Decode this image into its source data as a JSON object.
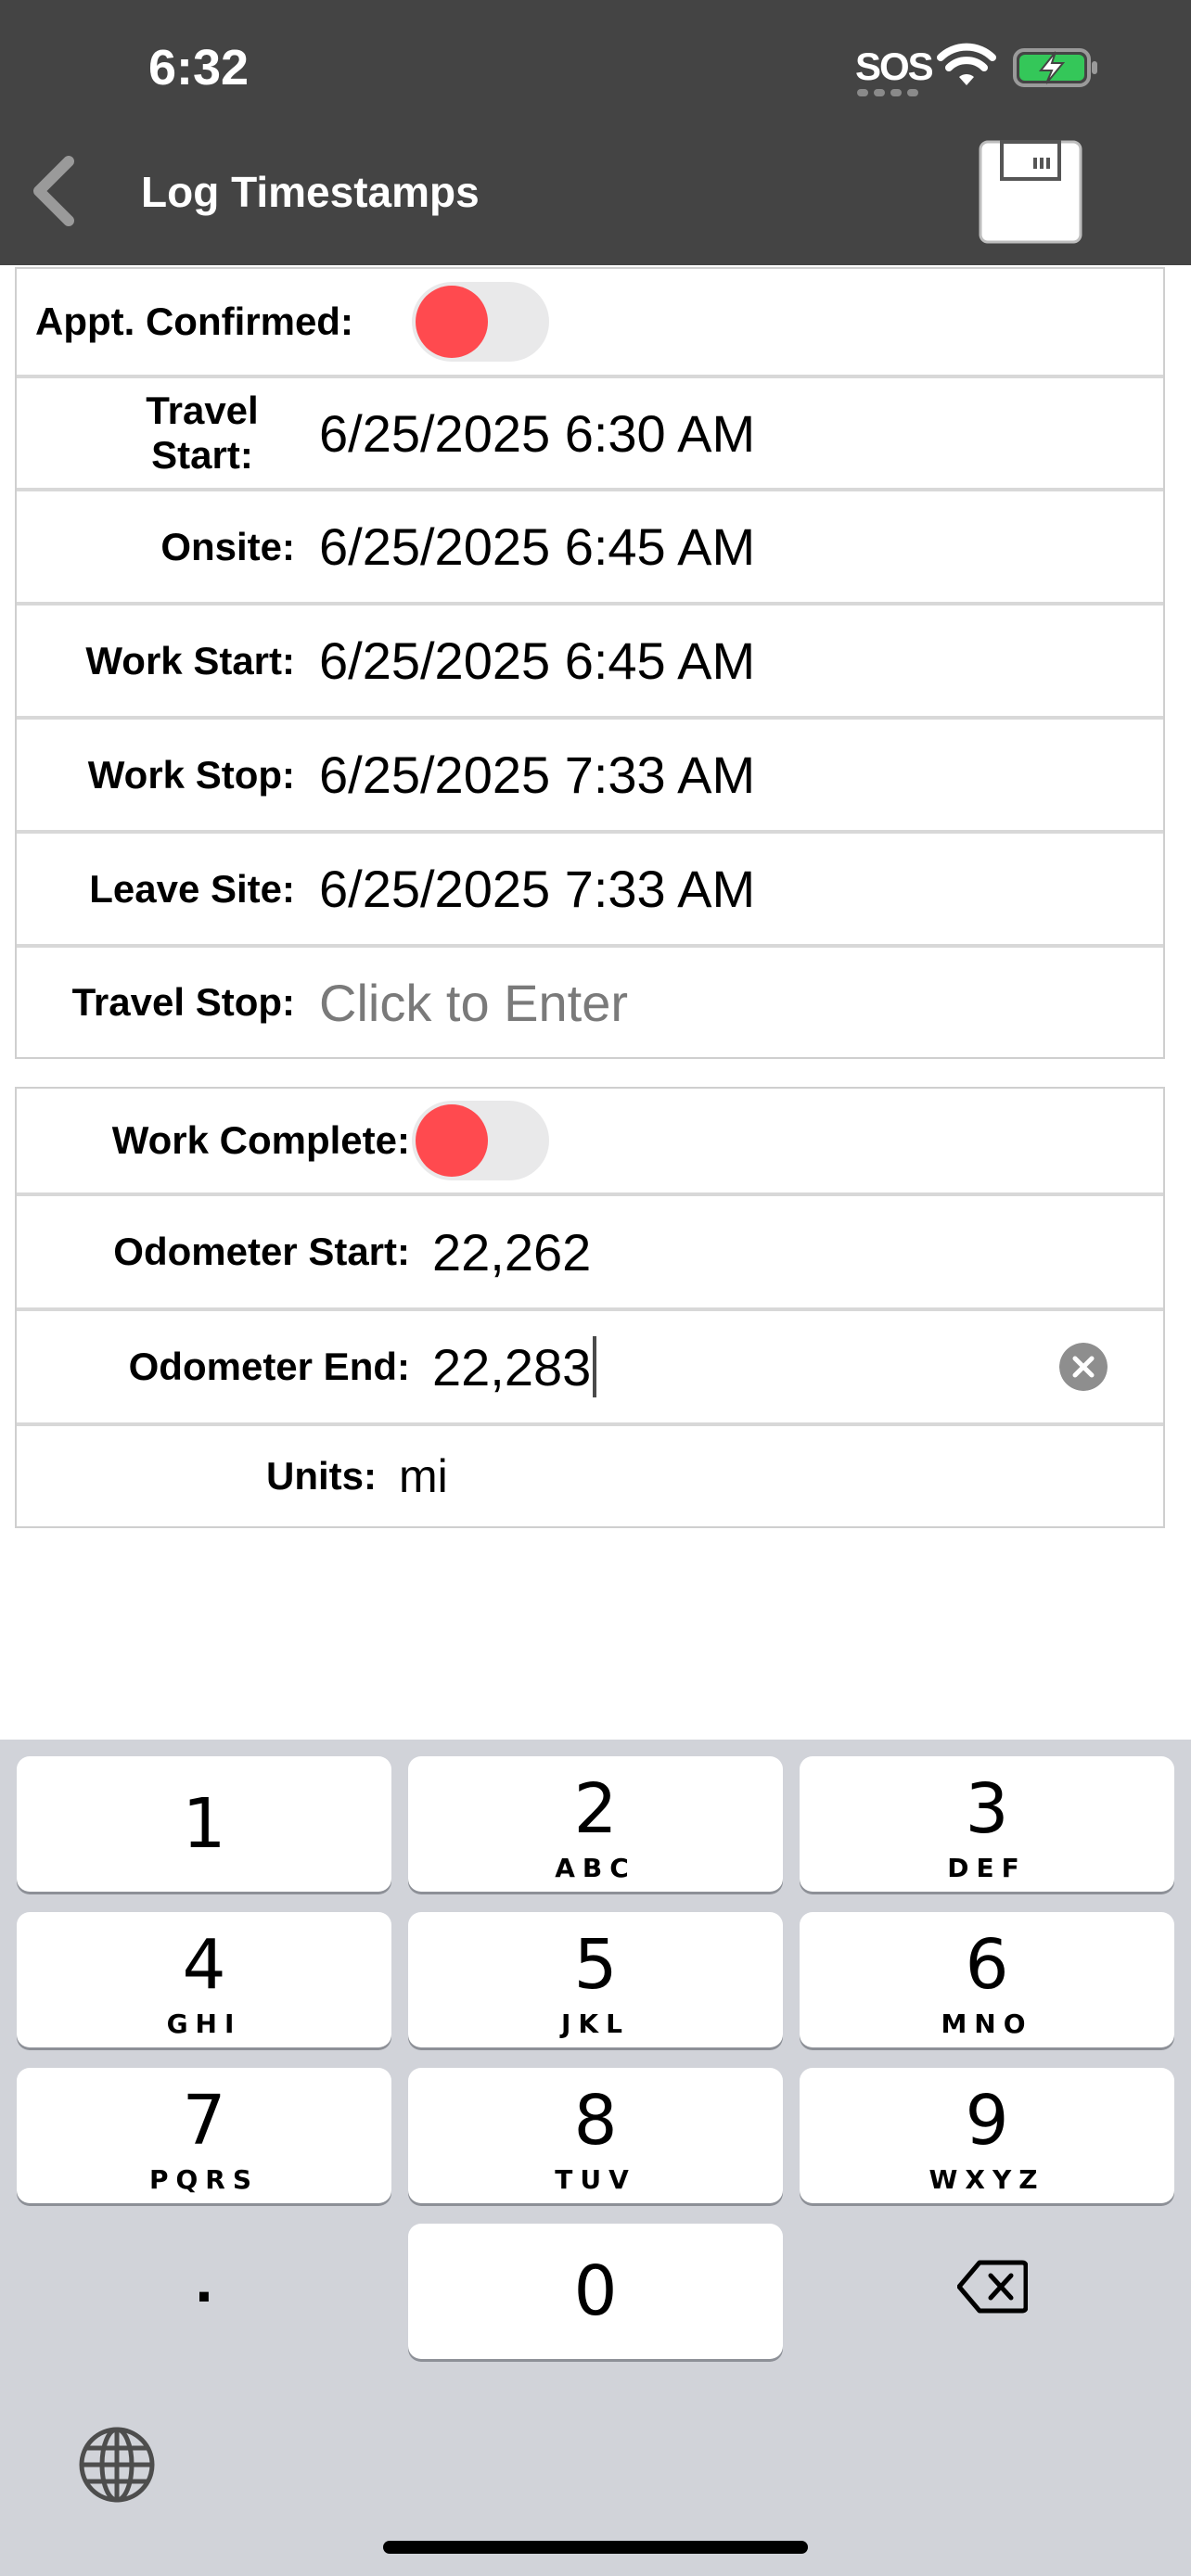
{
  "status_bar": {
    "time": "6:32",
    "sos": "SOS"
  },
  "nav": {
    "title": "Log Timestamps"
  },
  "timestamps_group": {
    "appt_confirmed": {
      "label": "Appt. Confirmed:"
    },
    "rows": [
      {
        "label": "Travel Start:",
        "value": "6/25/2025 6:30 AM"
      },
      {
        "label": "Onsite:",
        "value": "6/25/2025 6:45 AM"
      },
      {
        "label": "Work Start:",
        "value": "6/25/2025 6:45 AM"
      },
      {
        "label": "Work Stop:",
        "value": "6/25/2025 7:33 AM"
      },
      {
        "label": "Leave Site:",
        "value": "6/25/2025 7:33 AM"
      },
      {
        "label": "Travel Stop:",
        "placeholder": "Click to Enter"
      }
    ]
  },
  "completion_group": {
    "work_complete": {
      "label": "Work Complete:"
    },
    "odometer_start": {
      "label": "Odometer Start:",
      "value": "22,262"
    },
    "odometer_end": {
      "label": "Odometer End:",
      "value": "22,283"
    },
    "units": {
      "label": "Units:",
      "value": "mi"
    }
  },
  "keyboard": {
    "keys": [
      {
        "digit": "1",
        "letters": ""
      },
      {
        "digit": "2",
        "letters": "ABC"
      },
      {
        "digit": "3",
        "letters": "DEF"
      },
      {
        "digit": "4",
        "letters": "GHI"
      },
      {
        "digit": "5",
        "letters": "JKL"
      },
      {
        "digit": "6",
        "letters": "MNO"
      },
      {
        "digit": "7",
        "letters": "PQRS"
      },
      {
        "digit": "8",
        "letters": "TUV"
      },
      {
        "digit": "9",
        "letters": "WXYZ"
      },
      {
        "digit": "0",
        "letters": ""
      }
    ],
    "decimal": "."
  },
  "colors": {
    "header_bg": "#444444",
    "toggle_knob": "#ff4a4f",
    "keyboard_bg": "#d1d3d9",
    "battery_fill": "#34c759"
  },
  "icons": {
    "back": "chevron-left-icon",
    "save": "floppy-disk-icon",
    "clear": "clear-circle-icon",
    "backspace": "backspace-icon",
    "globe": "globe-icon"
  }
}
